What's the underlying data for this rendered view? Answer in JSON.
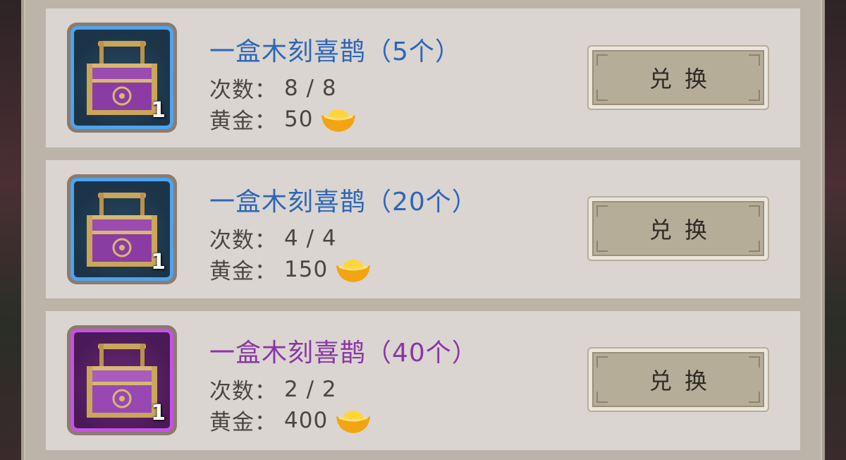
{
  "items": [
    {
      "title": "一盒木刻喜鹊（5个）",
      "rarity": "blue",
      "quantity": "1",
      "times_label": "次数：",
      "times_value": "8 / 8",
      "cost_label": "黄金：",
      "cost_value": "50",
      "button_label": "兑换"
    },
    {
      "title": "一盒木刻喜鹊（20个）",
      "rarity": "blue",
      "quantity": "1",
      "times_label": "次数：",
      "times_value": "4 / 4",
      "cost_label": "黄金：",
      "cost_value": "150",
      "button_label": "兑换"
    },
    {
      "title": "一盒木刻喜鹊（40个）",
      "rarity": "purple",
      "quantity": "1",
      "times_label": "次数：",
      "times_value": "2 / 2",
      "cost_label": "黄金：",
      "cost_value": "400",
      "button_label": "兑换"
    }
  ],
  "icons": {
    "item": "treasure-chest-icon",
    "currency": "gold-ingot-icon"
  },
  "colors": {
    "blue_title": "#2d66b8",
    "purple_title": "#8a36a6",
    "blue_border": "#4ea4ee",
    "purple_border": "#c552e6"
  }
}
